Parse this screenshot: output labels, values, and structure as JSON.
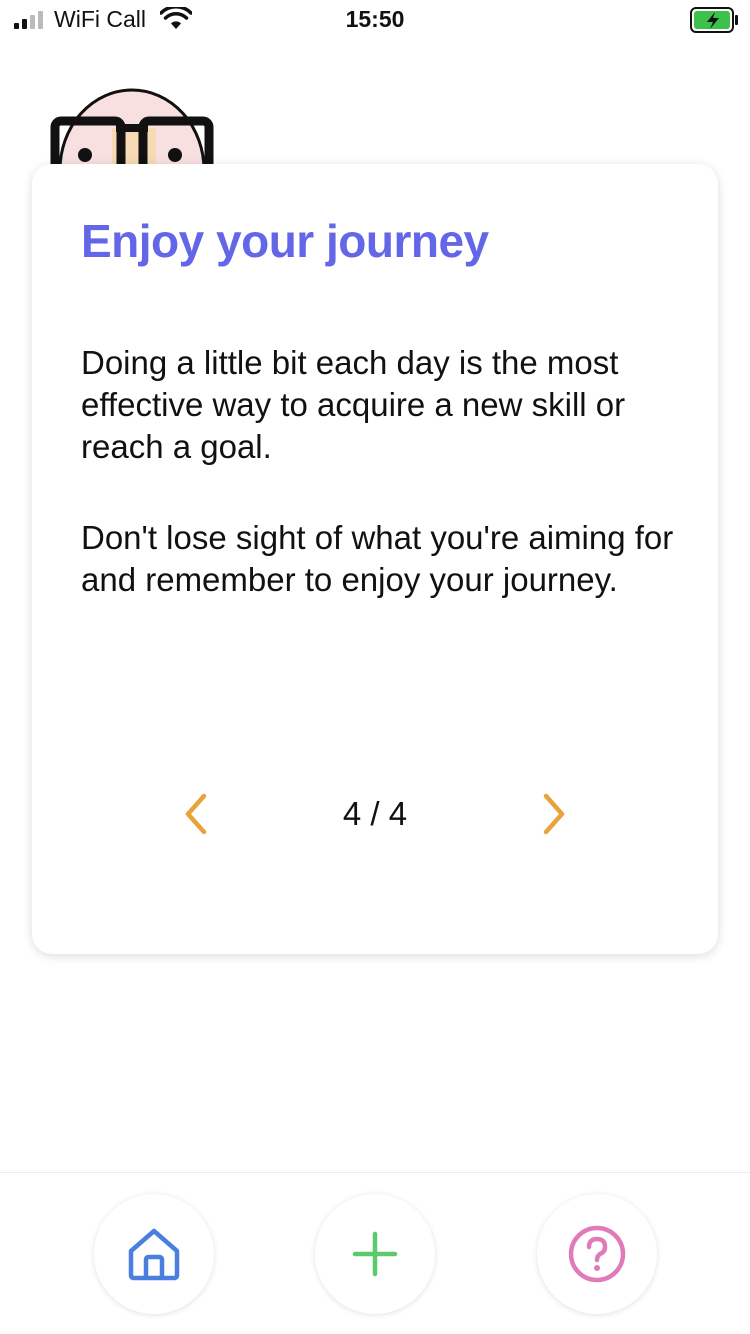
{
  "status_bar": {
    "carrier": "WiFi Call",
    "time": "15:50",
    "icons": [
      "signal-icon",
      "wifi-icon",
      "battery-charging-icon"
    ]
  },
  "card": {
    "title": "Enjoy your journey",
    "paragraph_1": "Doing a little bit each day is the most effective way to acquire a new skill or reach a goal.",
    "paragraph_2": "Don't lose sight of what you're aiming for and remember to enjoy your journey.",
    "pager": {
      "current": "4",
      "separator": "/",
      "total": "4",
      "label": "4 / 4",
      "prev_icon": "chevron-left-icon",
      "next_icon": "chevron-right-icon"
    }
  },
  "bottom_nav": {
    "items": [
      {
        "name": "home",
        "icon": "home-icon",
        "color": "#4a7fe0"
      },
      {
        "name": "add",
        "icon": "plus-icon",
        "color": "#5cc96a"
      },
      {
        "name": "help",
        "icon": "help-icon",
        "color": "#e07ab8"
      }
    ]
  },
  "colors": {
    "title": "#6366e6",
    "arrows": "#e8a33a",
    "home": "#4a7fe0",
    "add": "#5cc96a",
    "help": "#e07ab8",
    "battery": "#3cc14b"
  }
}
